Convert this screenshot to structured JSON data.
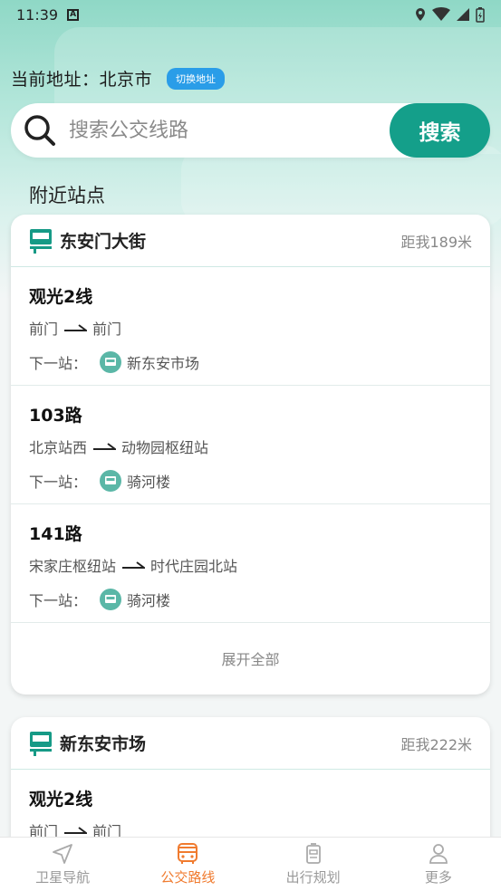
{
  "status": {
    "time": "11:39",
    "a_icon": "A"
  },
  "location": {
    "label": "当前地址：北京市",
    "switch_label": "切换地址"
  },
  "search": {
    "placeholder": "搜索公交线路",
    "button_label": "搜索"
  },
  "nearby": {
    "title": "附近站点",
    "expand_label": "展开全部",
    "stations": [
      {
        "name": "东安门大街",
        "distance": "距我189米",
        "routes": [
          {
            "name": "观光2线",
            "from": "前门",
            "to": "前门",
            "next_label": "下一站：",
            "next_stop": "新东安市场"
          },
          {
            "name": "103路",
            "from": "北京站西",
            "to": "动物园枢纽站",
            "next_label": "下一站：",
            "next_stop": "骑河楼"
          },
          {
            "name": "141路",
            "from": "宋家庄枢纽站",
            "to": "时代庄园北站",
            "next_label": "下一站：",
            "next_stop": "骑河楼"
          }
        ]
      },
      {
        "name": "新东安市场",
        "distance": "距我222米",
        "routes": [
          {
            "name": "观光2线",
            "from": "前门",
            "to": "前门"
          }
        ]
      }
    ]
  },
  "tabs": [
    {
      "label": "卫星导航",
      "icon": "navigation-arrow-icon",
      "active": false
    },
    {
      "label": "公交路线",
      "icon": "bus-icon",
      "active": true
    },
    {
      "label": "出行规划",
      "icon": "plan-icon",
      "active": false
    },
    {
      "label": "更多",
      "icon": "user-icon",
      "active": false
    }
  ],
  "colors": {
    "primary": "#149f8a",
    "accent_tab": "#f07b2f",
    "switch_btn": "#2a9de8"
  }
}
